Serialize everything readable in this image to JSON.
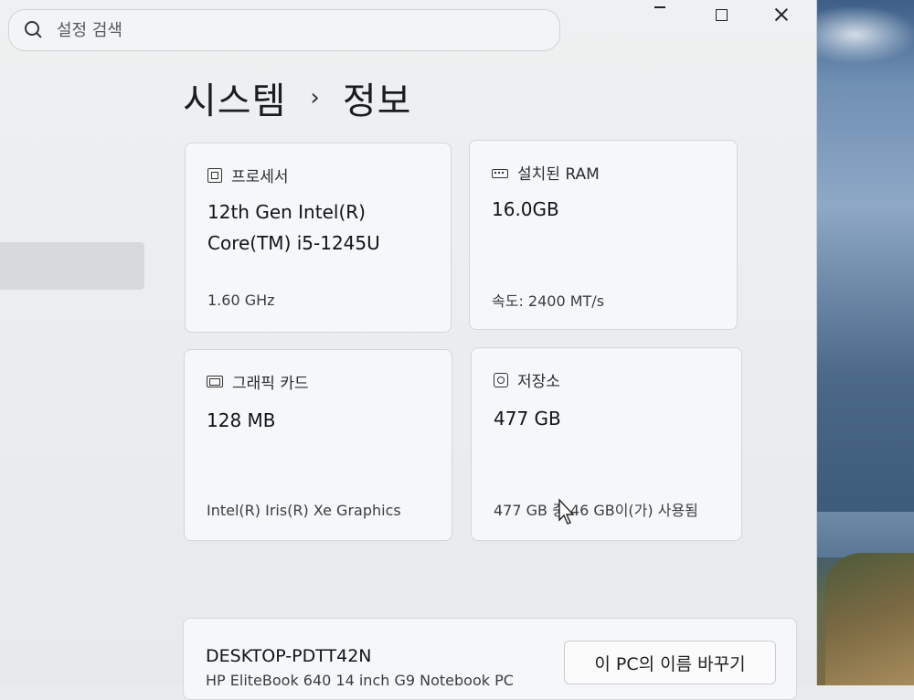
{
  "search": {
    "placeholder": "설정 검색"
  },
  "breadcrumb": {
    "parent": "시스템",
    "separator": "›",
    "current": "정보"
  },
  "cards": {
    "processor": {
      "label": "프로세서",
      "value": "12th Gen Intel(R)\nCore(TM) i5-1245U",
      "sub": "1.60 GHz",
      "icon": "cpu-icon"
    },
    "ram": {
      "label": "설치된 RAM",
      "value": "16.0GB",
      "sub": "속도: 2400 MT/s",
      "icon": "ram-icon"
    },
    "graphics": {
      "label": "그래픽 카드",
      "value": "128 MB",
      "sub": "Intel(R) Iris(R) Xe Graphics",
      "icon": "gpu-icon"
    },
    "storage": {
      "label": "저장소",
      "value": "477 GB",
      "sub": "477 GB 중 46 GB이(가) 사용됨",
      "icon": "drive-icon"
    }
  },
  "device": {
    "name": "DESKTOP-PDTT42N",
    "model": "HP EliteBook 640 14 inch G9 Notebook PC",
    "rename_label": "이 PC의 이름 바꾸기"
  }
}
